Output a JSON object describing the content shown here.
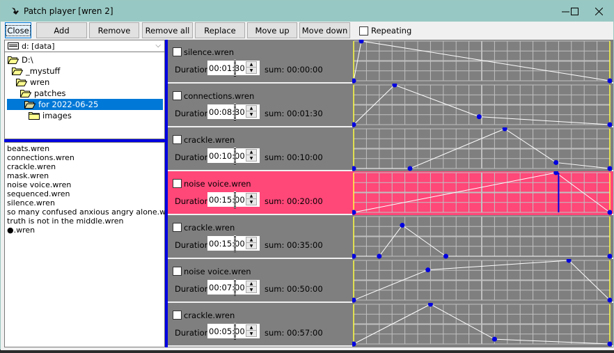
{
  "window": {
    "title": "Patch player [wren 2]",
    "controls": [
      "minimize",
      "maximize",
      "close"
    ]
  },
  "toolbar": {
    "buttons": [
      {
        "id": "close",
        "label": "Close",
        "focused": true
      },
      {
        "id": "add",
        "label": "Add"
      },
      {
        "id": "remove",
        "label": "Remove"
      },
      {
        "id": "remove-all",
        "label": "Remove all"
      },
      {
        "id": "replace",
        "label": "Replace"
      },
      {
        "id": "move-up",
        "label": "Move up"
      },
      {
        "id": "move-down",
        "label": "Move down"
      }
    ],
    "repeating_label": "Repeating",
    "repeating_checked": false
  },
  "drive": {
    "label": "d: [data]",
    "icon": "drive-icon"
  },
  "tree": [
    {
      "label": "D:\\",
      "depth": 0,
      "open": true
    },
    {
      "label": "_mystuff",
      "depth": 1,
      "open": true
    },
    {
      "label": "wren",
      "depth": 2,
      "open": true
    },
    {
      "label": "patches",
      "depth": 3,
      "open": true
    },
    {
      "label": "for 2022-06-25",
      "depth": 4,
      "open": true,
      "selected": true
    },
    {
      "label": "images",
      "depth": 5,
      "open": false
    }
  ],
  "files": [
    "beats.wren",
    "connections.wren",
    "crackle.wren",
    "mask.wren",
    "noise voice.wren",
    "sequenced.wren",
    "silence.wren",
    "so many confused anxious angry alone.wren",
    "truth is not in the middle.wren",
    "●.wren"
  ],
  "playlist": {
    "duration_label": "Duration",
    "sum_prefix": "sum: ",
    "items": [
      {
        "name": "silence.wren",
        "duration": "00:01:30",
        "sum": "00:00:00",
        "checked": false,
        "active": false,
        "envelope": [
          [
            0,
            0
          ],
          [
            0.03,
            1
          ],
          [
            1,
            0
          ]
        ]
      },
      {
        "name": "connections.wren",
        "duration": "00:08:30",
        "sum": "00:01:30",
        "checked": false,
        "active": false,
        "envelope": [
          [
            0,
            0
          ],
          [
            0.16,
            1
          ],
          [
            0.49,
            0.2
          ],
          [
            1,
            0
          ]
        ]
      },
      {
        "name": "crackle.wren",
        "duration": "00:10:00",
        "sum": "00:10:00",
        "checked": false,
        "active": false,
        "envelope": [
          [
            0,
            0
          ],
          [
            0.22,
            0
          ],
          [
            0.59,
            1
          ],
          [
            0.79,
            0.15
          ],
          [
            1,
            0
          ]
        ]
      },
      {
        "name": "noise voice.wren",
        "duration": "00:15:00",
        "sum": "00:20:00",
        "checked": false,
        "active": true,
        "playhead": 0.8,
        "envelope": [
          [
            0,
            0
          ],
          [
            0.79,
            1
          ],
          [
            1,
            0
          ]
        ]
      },
      {
        "name": "crackle.wren",
        "duration": "00:15:00",
        "sum": "00:35:00",
        "checked": false,
        "active": false,
        "envelope": [
          [
            0,
            0
          ],
          [
            0.1,
            0
          ],
          [
            0.19,
            0.78
          ],
          [
            0.36,
            0
          ],
          [
            1,
            0
          ]
        ]
      },
      {
        "name": "noise voice.wren",
        "duration": "00:07:00",
        "sum": "00:50:00",
        "checked": false,
        "active": false,
        "envelope": [
          [
            0,
            0
          ],
          [
            0.29,
            0.76
          ],
          [
            0.84,
            1
          ],
          [
            1,
            0
          ]
        ]
      },
      {
        "name": "crackle.wren",
        "duration": "00:05:00",
        "sum": "00:57:00",
        "checked": false,
        "active": false,
        "envelope": [
          [
            0,
            0
          ],
          [
            0.3,
            1
          ],
          [
            0.55,
            0.12
          ],
          [
            1,
            0
          ]
        ]
      }
    ]
  },
  "colors": {
    "titlebar": "#98c8c3",
    "selection": "#0078d7",
    "splitter": "#0000e0",
    "row_bg": "#7f7f7f",
    "row_active": "#ff4778",
    "grid": "#c0c0c0",
    "envelope_line": "#ffffff",
    "envelope_point": "#0000e0",
    "envelope_edge": "#ffff40"
  }
}
